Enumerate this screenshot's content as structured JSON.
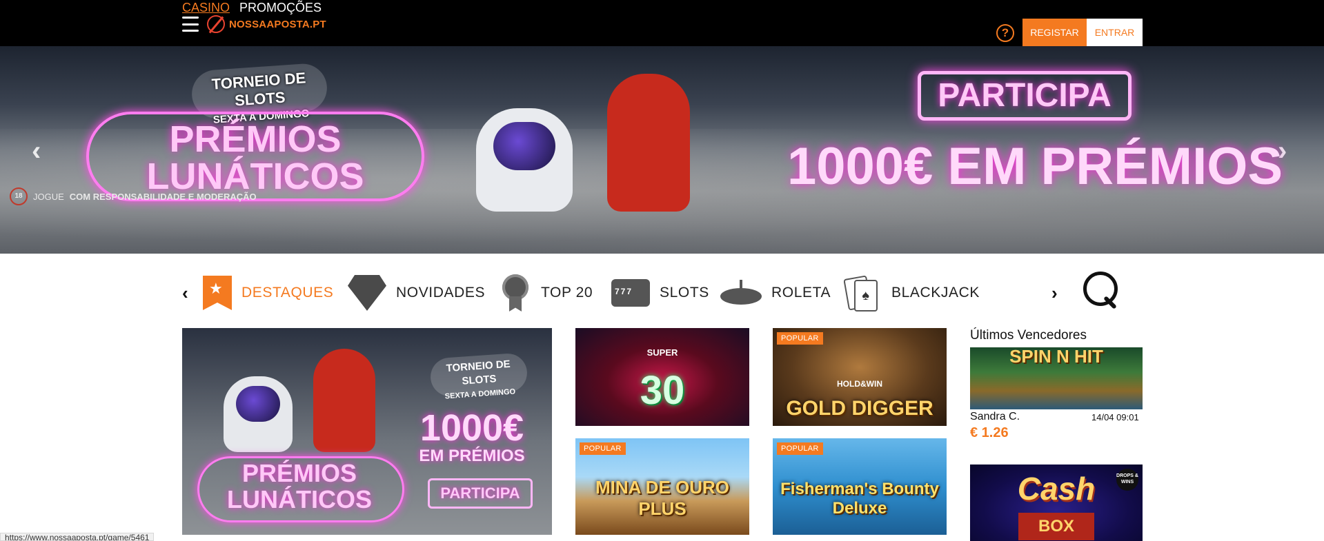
{
  "header": {
    "tabs": [
      {
        "label": "CASINO",
        "active": true
      },
      {
        "label": "PROMOÇÕES",
        "active": false
      }
    ],
    "logo_text": "NOSSAAPOSTA.PT",
    "help_label": "?",
    "register_label": "REGISTAR",
    "login_label": "ENTRAR",
    "accent_color": "#f47a20"
  },
  "banner": {
    "tournament_title": "TORNEIO DE SLOTS",
    "tournament_days": "SEXTA A DOMINGO",
    "headline": "PRÉMIOS LUNÁTICOS",
    "cta_label": "PARTICIPA",
    "prize_text": "1000€ EM PRÉMIOS",
    "age_badge": "18",
    "responsibility_prefix": "JOGUE",
    "responsibility_text": "COM RESPONSABILIDADE E MODERAÇÃO",
    "prev_arrow": "‹",
    "next_arrow": "›"
  },
  "categories": {
    "prev_arrow": "‹",
    "next_arrow": "›",
    "items": [
      {
        "label": "DESTAQUES",
        "icon": "bookmark-star-icon",
        "active": true
      },
      {
        "label": "NOVIDADES",
        "icon": "diamond-icon",
        "active": false
      },
      {
        "label": "TOP 20",
        "icon": "award-icon",
        "active": false
      },
      {
        "label": "SLOTS",
        "icon": "slot-machine-icon",
        "active": false
      },
      {
        "label": "ROLETA",
        "icon": "roulette-icon",
        "active": false
      },
      {
        "label": "BLACKJACK",
        "icon": "playing-cards-icon",
        "active": false
      }
    ],
    "search_icon": "search-icon"
  },
  "promo_tile": {
    "tournament_title": "TORNEIO DE SLOTS",
    "tournament_days": "SEXTA A DOMINGO",
    "amount": "1000€",
    "amount_sub": "EM PRÉMIOS",
    "headline": "PRÉMIOS LUNÁTICOS",
    "cta_label": "PARTICIPA"
  },
  "games": [
    {
      "title": "30",
      "subtitle": "SUPER",
      "badge": ""
    },
    {
      "title": "GOLD DIGGER",
      "subtitle": "HOLD&WIN",
      "badge": "POPULAR"
    },
    {
      "title": "MINA DE OURO PLUS",
      "subtitle": "",
      "badge": "POPULAR"
    },
    {
      "title": "Fisherman's Bounty Deluxe",
      "subtitle": "",
      "badge": "POPULAR"
    }
  ],
  "winners": {
    "title": "Últimos Vencedores",
    "items": [
      {
        "game_title": "SPIN N HIT",
        "name": "Sandra C.",
        "time": "14/04 09:01",
        "amount": "€ 1.26"
      }
    ],
    "next_game_title": "Cash",
    "next_game_sub": "BOX",
    "next_game_badge": "DROPS & WINS"
  },
  "status_bar": {
    "url": "https://www.nossaaposta.pt/game/5461"
  }
}
